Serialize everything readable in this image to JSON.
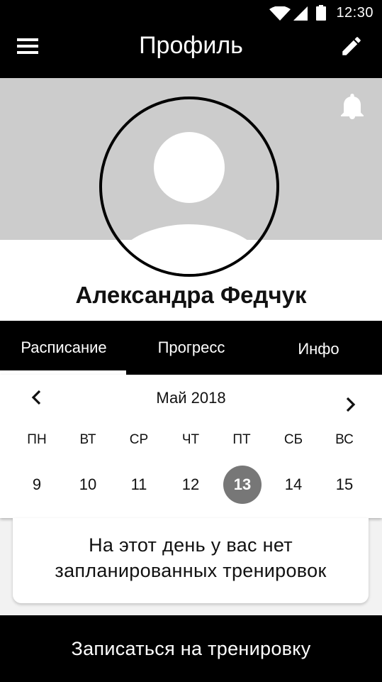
{
  "status_bar": {
    "time": "12:30",
    "icons": [
      "wifi-icon",
      "signal-icon",
      "battery-icon"
    ]
  },
  "app_bar": {
    "title": "Профиль",
    "left_icon": "menu-icon",
    "right_icon": "edit-icon"
  },
  "profile": {
    "name": "Александра Федчук",
    "notification_icon": "bell-icon",
    "avatar_icon": "avatar-placeholder-icon"
  },
  "tabs": [
    {
      "label": "Расписание",
      "active": true
    },
    {
      "label": "Прогресс",
      "active": false
    },
    {
      "label": "Инфо",
      "active": false
    }
  ],
  "calendar": {
    "month": "Май 2018",
    "weekdays": [
      "ПН",
      "ВТ",
      "СР",
      "ЧТ",
      "ПТ",
      "СБ",
      "ВС"
    ],
    "days": [
      "9",
      "10",
      "11",
      "12",
      "13",
      "14",
      "15"
    ],
    "selected_day": "13"
  },
  "empty_state": {
    "line1": "На этот день у вас нет",
    "line2": "запланированных тренировок"
  },
  "cta": {
    "label": "Записаться на тренировку"
  },
  "colors": {
    "bar": "#000000",
    "hero": "#cccccc",
    "selected_day": "#777777",
    "background": "#f2f2f2"
  }
}
